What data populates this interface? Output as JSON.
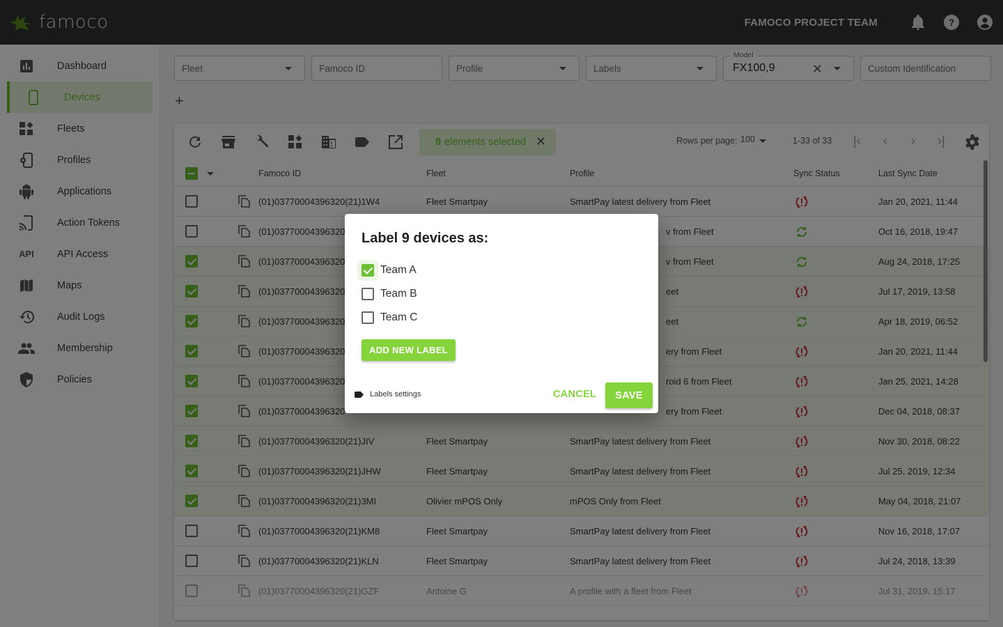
{
  "app": {
    "brand": "famoco",
    "team_name": "FAMOCO PROJECT TEAM",
    "accent_color": "#6cc132",
    "button_color": "#86d43b",
    "error_color": "#d0323f"
  },
  "topbar": {
    "icons": [
      "bell-icon",
      "help-icon",
      "account-icon"
    ]
  },
  "sidebar": {
    "items": [
      {
        "label": "Dashboard",
        "icon": "dashboard-icon",
        "active": false
      },
      {
        "label": "Devices",
        "icon": "device-icon",
        "active": true
      },
      {
        "label": "Fleets",
        "icon": "fleets-icon",
        "active": false
      },
      {
        "label": "Profiles",
        "icon": "profile-icon",
        "active": false
      },
      {
        "label": "Applications",
        "icon": "android-icon",
        "active": false
      },
      {
        "label": "Action Tokens",
        "icon": "cast-icon",
        "active": false
      },
      {
        "label": "API Access",
        "icon": "api-icon",
        "icon_text": "API",
        "active": false
      },
      {
        "label": "Maps",
        "icon": "map-icon",
        "active": false
      },
      {
        "label": "Audit Logs",
        "icon": "history-icon",
        "active": false
      },
      {
        "label": "Membership",
        "icon": "people-icon",
        "active": false
      },
      {
        "label": "Policies",
        "icon": "shield-icon",
        "active": false
      }
    ]
  },
  "filters": {
    "fleet": {
      "placeholder": "Fleet"
    },
    "famoco_id": {
      "placeholder": "Famoco ID"
    },
    "profile": {
      "placeholder": "Profile"
    },
    "labels": {
      "placeholder": "Labels"
    },
    "model": {
      "label": "Model",
      "value": "FX100,9"
    },
    "custom_id": {
      "placeholder": "Custom Identification"
    },
    "add_filter": "+"
  },
  "toolbar": {
    "selection_count": "9",
    "selection_text": "elements selected",
    "rows_per_page_label": "Rows per page:",
    "rows_per_page_value": "100",
    "page_range": "1-33 of 33"
  },
  "table": {
    "columns": [
      "Famoco ID",
      "Fleet",
      "Profile",
      "Sync Status",
      "Last Sync Date"
    ],
    "rows": [
      {
        "selected": false,
        "id": "(01)03770004396320(21)1W4",
        "fleet": "Fleet Smartpay",
        "profile": "SmartPay latest delivery from Fleet",
        "sync": "error",
        "date": "Jan 20, 2021, 11:44"
      },
      {
        "selected": false,
        "id": "(01)03770004396320",
        "fleet": "",
        "profile": "v from Fleet",
        "sync": "ok",
        "date": "Oct 16, 2018, 19:47"
      },
      {
        "selected": true,
        "id": "(01)03770004396320",
        "fleet": "",
        "profile": "v from Fleet",
        "sync": "ok",
        "date": "Aug 24, 2018, 17:25"
      },
      {
        "selected": true,
        "id": "(01)03770004396320",
        "fleet": "",
        "profile": "eet",
        "sync": "error",
        "date": "Jul 17, 2019, 13:58"
      },
      {
        "selected": true,
        "id": "(01)03770004396320",
        "fleet": "",
        "profile": "eet",
        "sync": "ok",
        "date": "Apr 18, 2019, 06:52"
      },
      {
        "selected": true,
        "id": "(01)03770004396320",
        "fleet": "",
        "profile": "ery from Fleet",
        "sync": "error",
        "date": "Jan 20, 2021, 11:44"
      },
      {
        "selected": true,
        "id": "(01)03770004396320",
        "fleet": "",
        "profile": "roid 6 from Fleet",
        "sync": "error",
        "date": "Jan 25, 2021, 14:28"
      },
      {
        "selected": true,
        "id": "(01)03770004396320",
        "fleet": "",
        "profile": "ery from Fleet",
        "sync": "error",
        "date": "Dec 04, 2018, 08:37"
      },
      {
        "selected": true,
        "id": "(01)03770004396320(21)JIV",
        "fleet": "Fleet Smartpay",
        "profile": "SmartPay latest delivery from Fleet",
        "sync": "error",
        "date": "Nov 30, 2018, 08:22"
      },
      {
        "selected": true,
        "id": "(01)03770004396320(21)JHW",
        "fleet": "Fleet Smartpay",
        "profile": "SmartPay latest delivery from Fleet",
        "sync": "error",
        "date": "Jul 25, 2019, 12:34"
      },
      {
        "selected": true,
        "id": "(01)03770004396320(21)3MI",
        "fleet": "Olivier mPOS Only",
        "profile": "mPOS Only from Fleet",
        "sync": "error",
        "date": "May 04, 2018, 21:07"
      },
      {
        "selected": false,
        "id": "(01)03770004396320(21)KM8",
        "fleet": "Fleet Smartpay",
        "profile": "SmartPay latest delivery from Fleet",
        "sync": "error",
        "date": "Nov 16, 2018, 17:07"
      },
      {
        "selected": false,
        "id": "(01)03770004396320(21)KLN",
        "fleet": "Fleet Smartpay",
        "profile": "SmartPay latest delivery from Fleet",
        "sync": "error",
        "date": "Jul 24, 2018, 13:39"
      },
      {
        "selected": false,
        "id": "(01)03770004396320(21)GZF",
        "fleet": "Antoine G",
        "profile": "A profile with a fleet from Fleet",
        "sync": "error",
        "date": "Jul 31, 2019, 15:17"
      }
    ]
  },
  "dialog": {
    "title": "Label 9 devices as:",
    "options": [
      {
        "label": "Team A",
        "checked": true
      },
      {
        "label": "Team B",
        "checked": false
      },
      {
        "label": "Team C",
        "checked": false
      }
    ],
    "add_label_button": "ADD NEW LABEL",
    "labels_settings_link": "Labels settings",
    "cancel_button": "CANCEL",
    "save_button": "SAVE"
  }
}
